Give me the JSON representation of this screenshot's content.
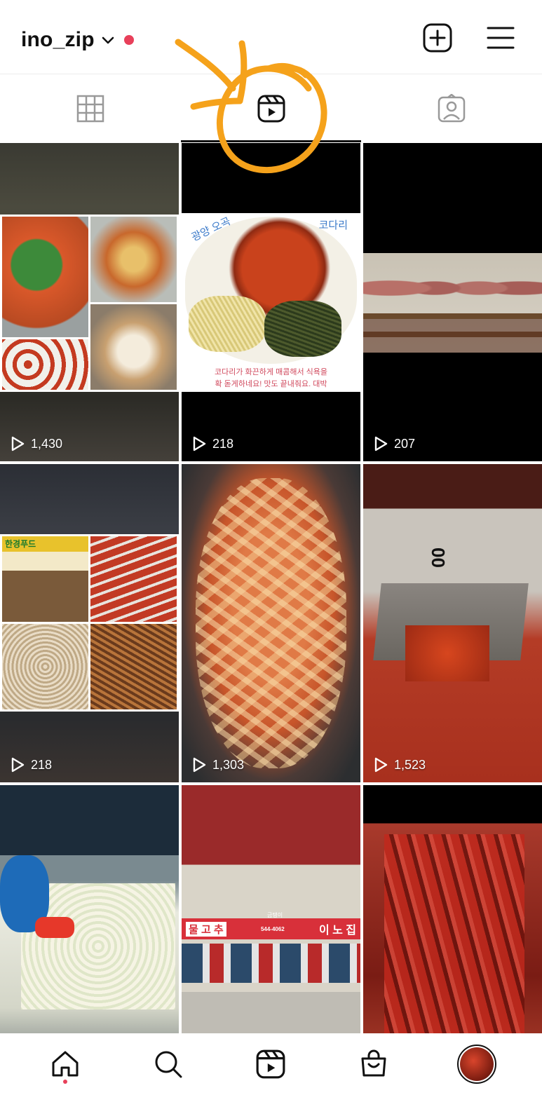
{
  "header": {
    "username": "ino_zip"
  },
  "tabs": [
    {
      "name": "grid-icon",
      "active": false
    },
    {
      "name": "reels-icon",
      "active": true
    },
    {
      "name": "tagged-icon",
      "active": false
    }
  ],
  "posts": [
    {
      "views": "1,430"
    },
    {
      "views": "218",
      "caption_line1": "코다리가 화끈하게 매콤해서 식욕을",
      "caption_line2": "확 돋게하네요! 맛도 끝내줘요. 대박",
      "sticker_left": "광양 오곡",
      "sticker_right": "코다리"
    },
    {
      "views": "207"
    },
    {
      "views": "218",
      "shop_sign": "한경푸드"
    },
    {
      "views": "1,303"
    },
    {
      "views": "1,523",
      "label": "00"
    },
    {
      "views": ""
    },
    {
      "views": "",
      "sign_left": "물 고 추",
      "sign_center": "금탱이",
      "sign_phone": "544-4062",
      "sign_right": "이 노 집"
    },
    {
      "views": ""
    }
  ],
  "nav": {
    "items": [
      "home-icon",
      "search-icon",
      "reels-icon",
      "shop-icon",
      "profile-avatar"
    ]
  },
  "colors": {
    "annotation": "#f5a21b",
    "notification": "#e8405a"
  }
}
